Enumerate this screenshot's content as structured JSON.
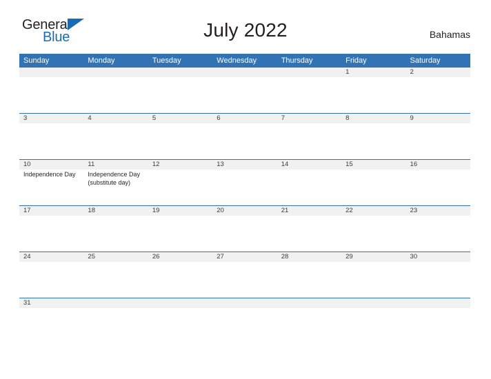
{
  "brand": {
    "name_part1": "General",
    "name_part2": "Blue",
    "flag_icon": "blue-triangle-flag-icon"
  },
  "header": {
    "title": "July 2022",
    "country": "Bahamas"
  },
  "calendar": {
    "weekday_headers": [
      "Sunday",
      "Monday",
      "Tuesday",
      "Wednesday",
      "Thursday",
      "Friday",
      "Saturday"
    ],
    "accent_color": "#3173b5",
    "band_color": "#f1f1f1",
    "weeks": [
      [
        {
          "date": ""
        },
        {
          "date": ""
        },
        {
          "date": ""
        },
        {
          "date": ""
        },
        {
          "date": ""
        },
        {
          "date": "1"
        },
        {
          "date": "2"
        }
      ],
      [
        {
          "date": "3"
        },
        {
          "date": "4"
        },
        {
          "date": "5"
        },
        {
          "date": "6"
        },
        {
          "date": "7"
        },
        {
          "date": "8"
        },
        {
          "date": "9"
        }
      ],
      [
        {
          "date": "10",
          "event": "Independence Day"
        },
        {
          "date": "11",
          "event": "Independence Day (substitute day)"
        },
        {
          "date": "12"
        },
        {
          "date": "13"
        },
        {
          "date": "14"
        },
        {
          "date": "15"
        },
        {
          "date": "16"
        }
      ],
      [
        {
          "date": "17"
        },
        {
          "date": "18"
        },
        {
          "date": "19"
        },
        {
          "date": "20"
        },
        {
          "date": "21"
        },
        {
          "date": "22"
        },
        {
          "date": "23"
        }
      ],
      [
        {
          "date": "24"
        },
        {
          "date": "25"
        },
        {
          "date": "26"
        },
        {
          "date": "27"
        },
        {
          "date": "28"
        },
        {
          "date": "29"
        },
        {
          "date": "30"
        }
      ],
      [
        {
          "date": "31"
        },
        {
          "date": ""
        },
        {
          "date": ""
        },
        {
          "date": ""
        },
        {
          "date": ""
        },
        {
          "date": ""
        },
        {
          "date": ""
        }
      ]
    ]
  }
}
